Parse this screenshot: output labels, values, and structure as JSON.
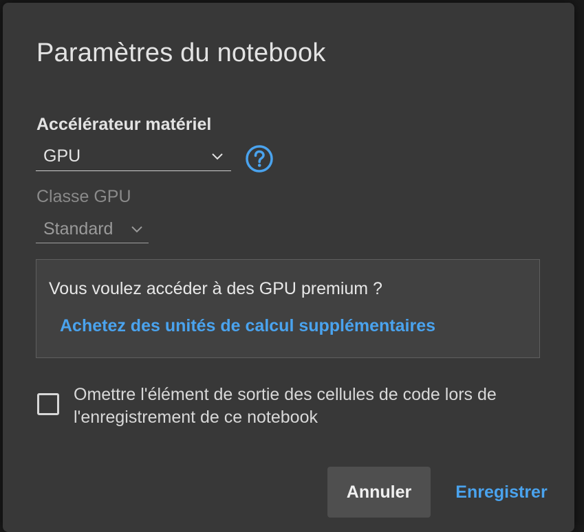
{
  "dialog": {
    "title": "Paramètres du notebook"
  },
  "accelerator": {
    "label": "Accélérateur matériel",
    "value": "GPU",
    "help_icon": "help-circle-icon"
  },
  "gpu_class": {
    "label": "Classe GPU",
    "value": "Standard"
  },
  "premium": {
    "text": "Vous voulez accéder à des GPU premium ?",
    "link": "Achetez des unités de calcul supplémentaires"
  },
  "omit_output": {
    "checked": false,
    "label": "Omettre l'élément de sortie des cellules de code lors de l'enregistrement de ce notebook"
  },
  "buttons": {
    "cancel": "Annuler",
    "save": "Enregistrer"
  },
  "colors": {
    "dialog_bg": "#383838",
    "accent": "#4aa3ee",
    "text": "#e3e3e3",
    "muted": "#8a8a8a"
  }
}
